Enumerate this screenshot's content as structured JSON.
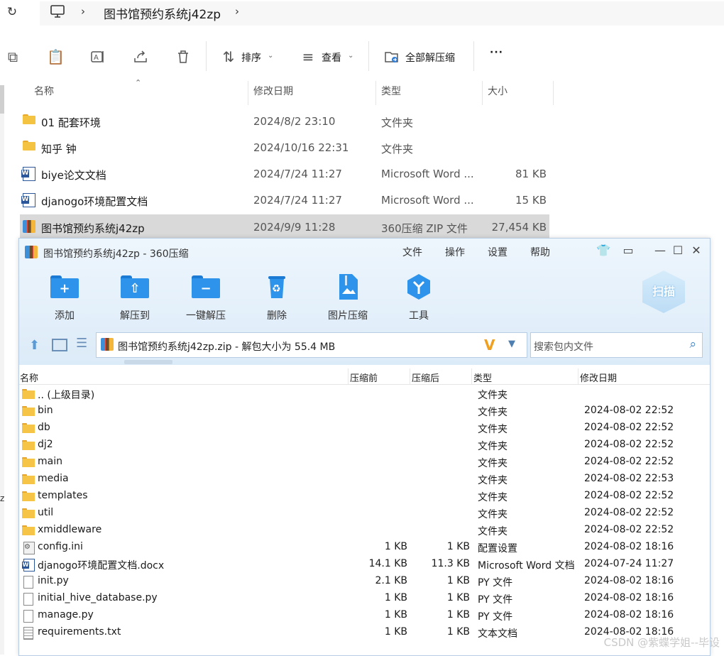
{
  "explorer": {
    "breadcrumb": "图书馆预约系统j42zp",
    "toolbar": {
      "sort_label": "排序",
      "view_label": "查看",
      "extract_all_label": "全部解压缩",
      "more_label": "···"
    },
    "columns": {
      "name": "名称",
      "modified": "修改日期",
      "type": "类型",
      "size": "大小"
    },
    "rows": [
      {
        "name": "01 配套环境",
        "modified": "2024/8/2 23:10",
        "type": "文件夹",
        "size": "",
        "icon": "folder-icon"
      },
      {
        "name": "知乎 钟",
        "modified": "2024/10/16 22:31",
        "type": "文件夹",
        "size": "",
        "icon": "folder-icon"
      },
      {
        "name": "biye论文文档",
        "modified": "2024/7/24 11:27",
        "type": "Microsoft Word ...",
        "size": "81 KB",
        "icon": "word-doc-icon"
      },
      {
        "name": "djanogo环境配置文档",
        "modified": "2024/7/24 11:27",
        "type": "Microsoft Word ...",
        "size": "15 KB",
        "icon": "word-doc-icon"
      },
      {
        "name": "图书馆预约系统j42zp",
        "modified": "2024/9/9 11:28",
        "type": "360压缩 ZIP 文件",
        "size": "27,454 KB",
        "icon": "zip-archive-icon",
        "selected": true
      }
    ],
    "stray_char": "z"
  },
  "zip_window": {
    "title": "图书馆预约系统j42zp - 360压缩",
    "menu": [
      "文件",
      "操作",
      "设置",
      "帮助"
    ],
    "tools": [
      "添加",
      "解压到",
      "一键解压",
      "删除",
      "图片压缩",
      "工具"
    ],
    "scan_label": "扫描",
    "path": "图书馆预约系统j42zp.zip - 解包大小为 55.4 MB",
    "search_placeholder": "搜索包内文件",
    "columns": {
      "name": "名称",
      "size": "压缩前",
      "compressed": "压缩后",
      "type": "类型",
      "modified": "修改日期"
    },
    "rows": [
      {
        "name": ".. (上级目录)",
        "size": "",
        "compressed": "",
        "type": "文件夹",
        "modified": "",
        "icon": "folder-up-icon"
      },
      {
        "name": "bin",
        "size": "",
        "compressed": "",
        "type": "文件夹",
        "modified": "2024-08-02 22:52",
        "icon": "folder-icon"
      },
      {
        "name": "db",
        "size": "",
        "compressed": "",
        "type": "文件夹",
        "modified": "2024-08-02 22:52",
        "icon": "folder-icon"
      },
      {
        "name": "dj2",
        "size": "",
        "compressed": "",
        "type": "文件夹",
        "modified": "2024-08-02 22:52",
        "icon": "folder-icon"
      },
      {
        "name": "main",
        "size": "",
        "compressed": "",
        "type": "文件夹",
        "modified": "2024-08-02 22:52",
        "icon": "folder-icon"
      },
      {
        "name": "media",
        "size": "",
        "compressed": "",
        "type": "文件夹",
        "modified": "2024-08-02 22:53",
        "icon": "folder-icon"
      },
      {
        "name": "templates",
        "size": "",
        "compressed": "",
        "type": "文件夹",
        "modified": "2024-08-02 22:52",
        "icon": "folder-icon"
      },
      {
        "name": "util",
        "size": "",
        "compressed": "",
        "type": "文件夹",
        "modified": "2024-08-02 22:52",
        "icon": "folder-icon"
      },
      {
        "name": "xmiddleware",
        "size": "",
        "compressed": "",
        "type": "文件夹",
        "modified": "2024-08-02 22:52",
        "icon": "folder-icon"
      },
      {
        "name": "config.ini",
        "size": "1 KB",
        "compressed": "1 KB",
        "type": "配置设置",
        "modified": "2024-08-02 18:16",
        "icon": "config-file-icon"
      },
      {
        "name": "djanogo环境配置文档.docx",
        "size": "14.1 KB",
        "compressed": "11.3 KB",
        "type": "Microsoft Word 文档",
        "modified": "2024-07-24 11:27",
        "icon": "word-doc-icon"
      },
      {
        "name": "init.py",
        "size": "2.1 KB",
        "compressed": "1 KB",
        "type": "PY 文件",
        "modified": "2024-08-02 18:16",
        "icon": "file-icon"
      },
      {
        "name": "initial_hive_database.py",
        "size": "1 KB",
        "compressed": "1 KB",
        "type": "PY 文件",
        "modified": "2024-08-02 18:16",
        "icon": "file-icon"
      },
      {
        "name": "manage.py",
        "size": "1 KB",
        "compressed": "1 KB",
        "type": "PY 文件",
        "modified": "2024-08-02 18:16",
        "icon": "file-icon"
      },
      {
        "name": "requirements.txt",
        "size": "1 KB",
        "compressed": "1 KB",
        "type": "文本文档",
        "modified": "2024-08-02 18:16",
        "icon": "text-file-icon"
      }
    ]
  },
  "watermark": "CSDN @紫蝶学姐--毕设",
  "colors": {
    "accent_blue": "#2e93ea",
    "folder_yellow": "#f5c342",
    "selection": "#d9d9d9"
  }
}
